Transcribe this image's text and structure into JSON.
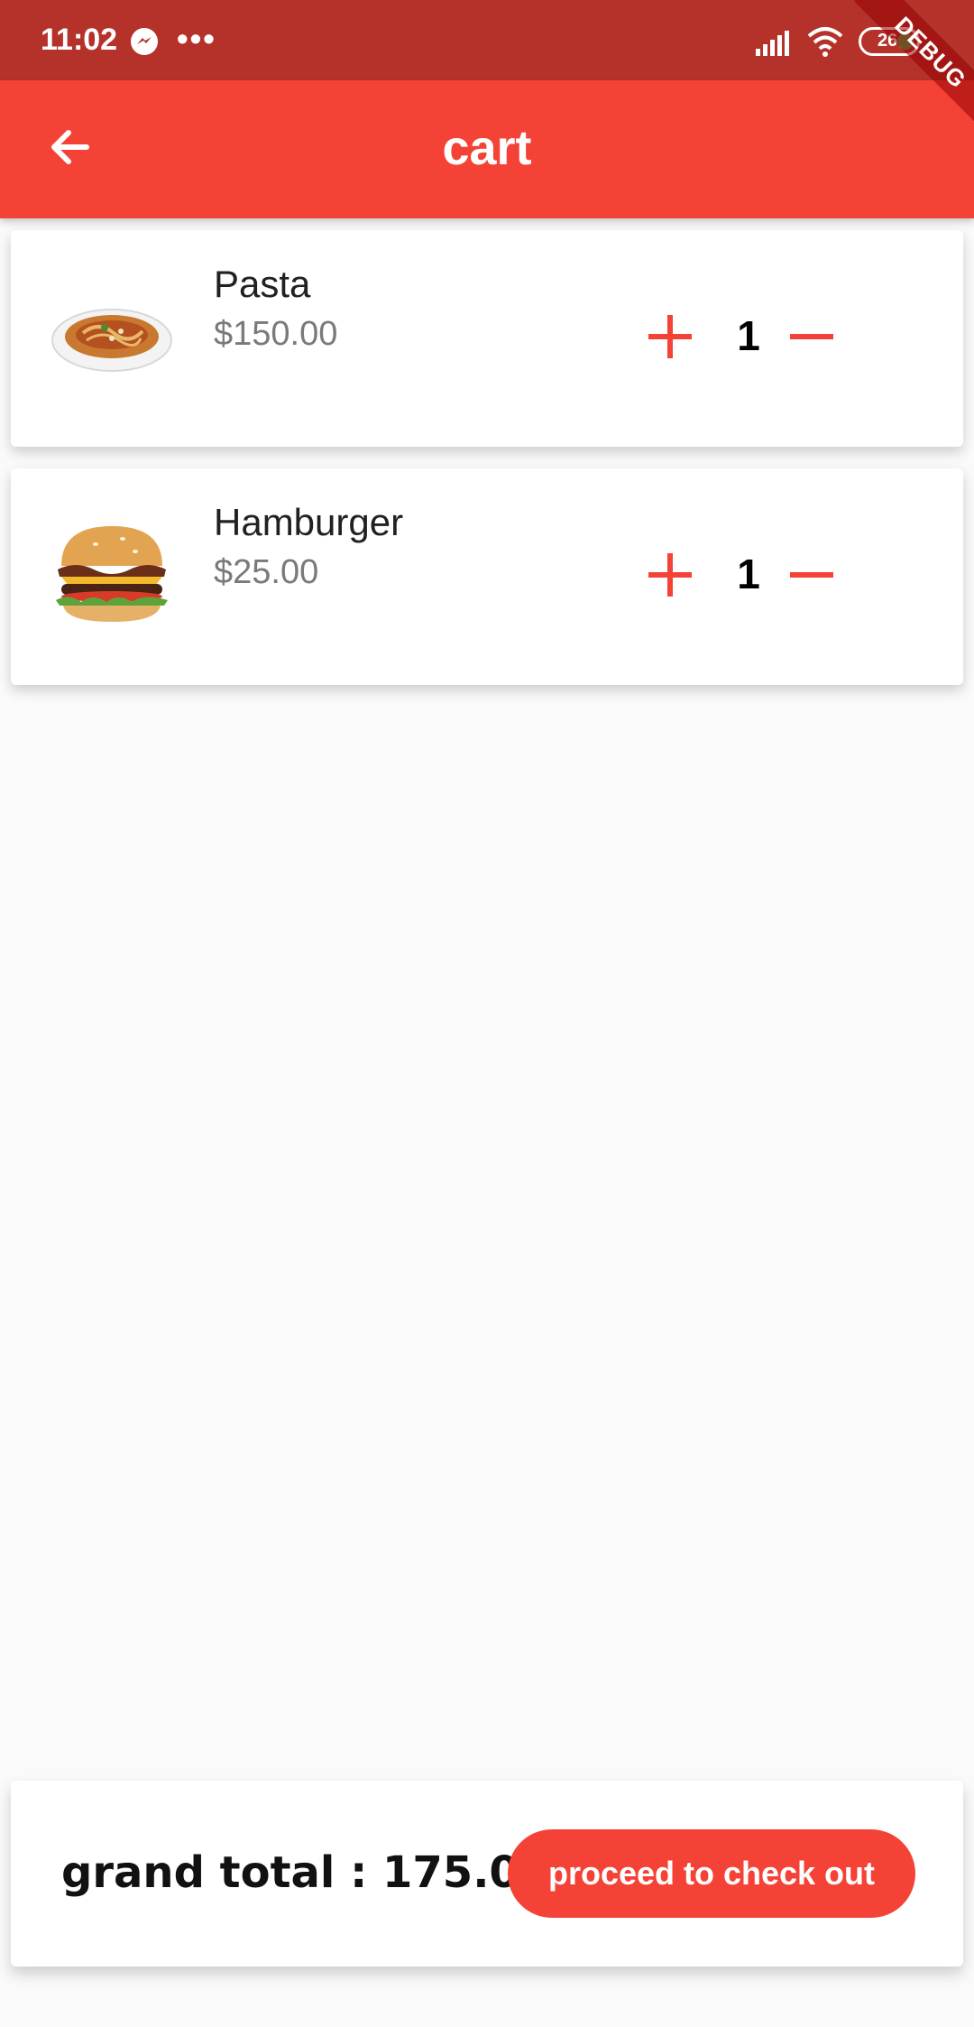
{
  "status_bar": {
    "time": "11:02",
    "dots": "•••",
    "battery_level": "26",
    "debug_label": "DEBUG"
  },
  "app_bar": {
    "title": "cart",
    "back_icon": "arrow-back-icon"
  },
  "cart": {
    "items": [
      {
        "name": "Pasta",
        "price": "$150.00",
        "quantity": "1",
        "image": "pasta-image"
      },
      {
        "name": "Hamburger",
        "price": "$25.00",
        "quantity": "1",
        "image": "hamburger-image"
      }
    ]
  },
  "footer": {
    "grand_total": "grand total : 175.0",
    "checkout_label": "proceed to check out"
  },
  "colors": {
    "primary": "#f44336",
    "status_bar": "#b5322a",
    "background": "#fafafa"
  }
}
